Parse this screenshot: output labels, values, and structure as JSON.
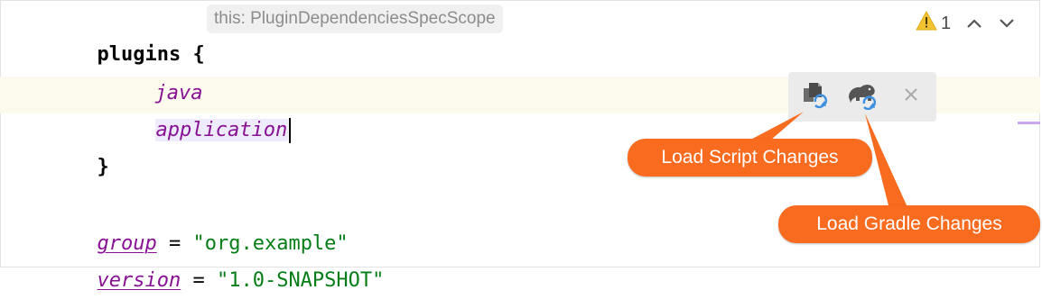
{
  "editor": {
    "lines": {
      "plugins_keyword": "plugins",
      "open_brace": " {",
      "java": "java",
      "application": "application",
      "close_brace": "}",
      "group_ident": "group",
      "group_eq": " = ",
      "group_value": "\"org.example\"",
      "version_ident": "version",
      "version_eq": " = ",
      "version_value": "\"1.0-SNAPSHOT\""
    },
    "inlay_hint": "this: PluginDependenciesSpecScope"
  },
  "inspection_widget": {
    "warning_count": "1",
    "warning_icon": "warning-triangle-icon",
    "up_icon": "chevron-up-icon",
    "down_icon": "chevron-down-icon"
  },
  "floating_toolbar": {
    "load_script_icon": "load-script-changes-icon",
    "load_gradle_icon": "gradle-elephant-refresh-icon",
    "close_icon": "close-icon"
  },
  "callouts": {
    "load_script": "Load Script Changes",
    "load_gradle": "Load Gradle Changes"
  },
  "colors": {
    "callout_bg": "#f96b1e",
    "string_green": "#067d17",
    "keyword_purple": "#871094",
    "refresh_blue": "#3d8fe0"
  }
}
